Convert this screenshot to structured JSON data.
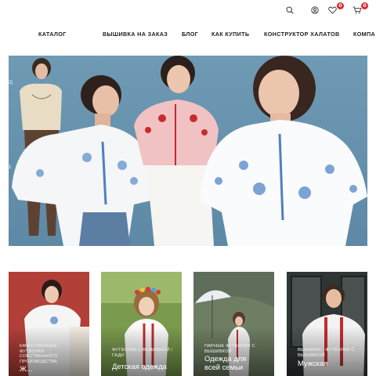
{
  "topbar": {
    "icons": [
      "search-icon",
      "account-icon",
      "heart-icon",
      "cart-icon"
    ],
    "wishlist_count": "0",
    "cart_count": "0",
    "badge_color": "#d62d2d"
  },
  "nav": {
    "items": [
      {
        "label": "КАТАЛОГ"
      },
      {
        "label": "ВЫШИВКА НА ЗАКАЗ"
      },
      {
        "label": "БЛОГ"
      },
      {
        "label": "КАК КУПИТЬ"
      },
      {
        "label": "КОНСТРУКТОР ХАЛАТОВ"
      },
      {
        "label": "КОМПА"
      }
    ]
  },
  "hero": {
    "slide_markers": [
      "2)",
      "1"
    ],
    "background_color": "#6589a5"
  },
  "cards": [
    {
      "subtitle": "КАЧЕСТВЕННЫЕ ФУТБОЛКИ СОБСТВЕННОГО ПРОИЗВОДСТВА",
      "title": "Ж..."
    },
    {
      "subtitle": "ФУТБОЛКИ С ВЫШИВКОЙ / ГАДИ",
      "title": "Детская одежда"
    },
    {
      "subtitle": "ПАРНЫЕ ФУТБОЛКИ С ВЫШИВКОЙ",
      "title": "Одежда для всей семьи"
    },
    {
      "subtitle": "ВЫШИВКА / ФУТБОЛКИ С ВЫШИВКОЙ",
      "title": "Мужская"
    }
  ]
}
